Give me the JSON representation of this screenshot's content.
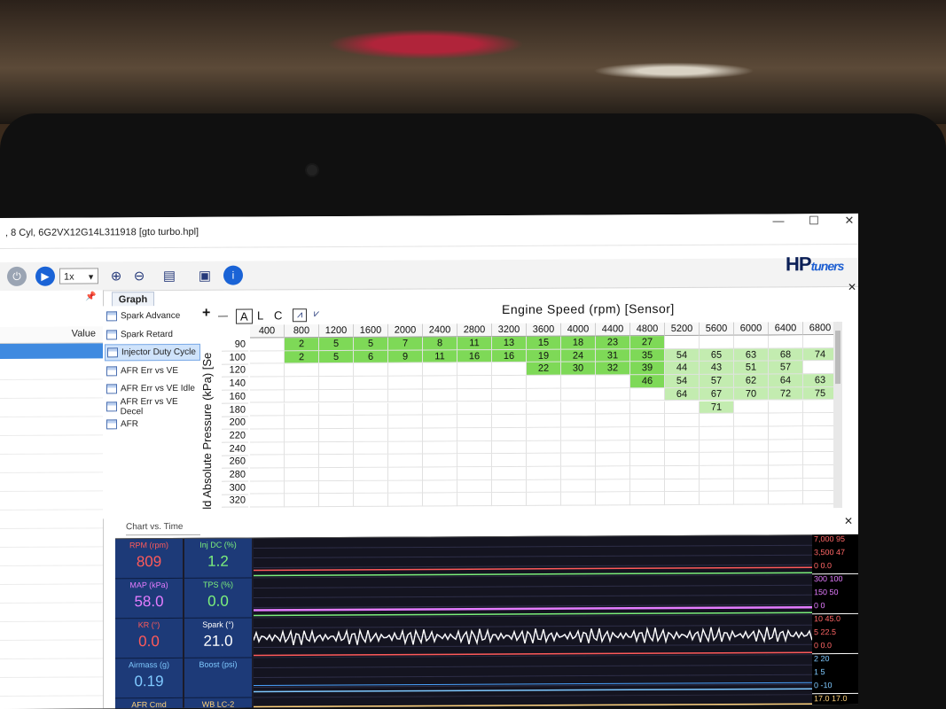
{
  "window": {
    "title": ", 8 Cyl, 6G2VX12G14L311918 [gto turbo.hpl]",
    "controls": {
      "minimize": "—",
      "maximize": "☐",
      "close": "✕"
    }
  },
  "toolbar": {
    "playback_rate": "1x",
    "logo_main": "HP",
    "logo_sub": "tuners"
  },
  "left_panel": {
    "value_header": "Value",
    "pin": "📌"
  },
  "tabs": {
    "graph_tab": "Graph",
    "items": [
      "Spark Advance",
      "Spark Retard",
      "Injector Duty Cycle",
      "AFR Err vs VE",
      "AFR Err vs VE Idle",
      "AFR Err vs VE Decel",
      "AFR"
    ],
    "selected": "Injector Duty Cycle"
  },
  "graph_toolbar": {
    "plus": "+",
    "minus": "—",
    "a": "A",
    "l": "L",
    "c": "C"
  },
  "table": {
    "x_title": "Engine Speed (rpm) [Sensor]",
    "y_title": "ld Absolute Pressure (kPa) [Se",
    "cols": [
      "400",
      "800",
      "1200",
      "1600",
      "2000",
      "2400",
      "2800",
      "3200",
      "3600",
      "4000",
      "4400",
      "4800",
      "5200",
      "5600",
      "6000",
      "6400",
      "6800"
    ],
    "rows": [
      {
        "kpa": "90",
        "cells": [
          "",
          "2",
          "5",
          "5",
          "7",
          "8",
          "11",
          "13",
          "15",
          "18",
          "23",
          "27",
          "",
          "",
          "",
          "",
          ""
        ]
      },
      {
        "kpa": "100",
        "cells": [
          "",
          "2",
          "5",
          "6",
          "9",
          "11",
          "16",
          "16",
          "19",
          "24",
          "31",
          "35",
          "54",
          "65",
          "63",
          "68",
          "74"
        ]
      },
      {
        "kpa": "120",
        "cells": [
          "",
          "",
          "",
          "",
          "",
          "",
          "",
          "",
          "22",
          "30",
          "32",
          "39",
          "44",
          "43",
          "51",
          "57",
          ""
        ]
      },
      {
        "kpa": "140",
        "cells": [
          "",
          "",
          "",
          "",
          "",
          "",
          "",
          "",
          "",
          "",
          "",
          "46",
          "54",
          "57",
          "62",
          "64",
          "63"
        ]
      },
      {
        "kpa": "160",
        "cells": [
          "",
          "",
          "",
          "",
          "",
          "",
          "",
          "",
          "",
          "",
          "",
          "",
          "64",
          "67",
          "70",
          "72",
          "75"
        ]
      },
      {
        "kpa": "180",
        "cells": [
          "",
          "",
          "",
          "",
          "",
          "",
          "",
          "",
          "",
          "",
          "",
          "",
          "",
          "71",
          "",
          "",
          ""
        ]
      },
      {
        "kpa": "200",
        "cells": [
          "",
          "",
          "",
          "",
          "",
          "",
          "",
          "",
          "",
          "",
          "",
          "",
          "",
          "",
          "",
          "",
          ""
        ]
      },
      {
        "kpa": "220",
        "cells": [
          "",
          "",
          "",
          "",
          "",
          "",
          "",
          "",
          "",
          "",
          "",
          "",
          "",
          "",
          "",
          "",
          ""
        ]
      },
      {
        "kpa": "240",
        "cells": [
          "",
          "",
          "",
          "",
          "",
          "",
          "",
          "",
          "",
          "",
          "",
          "",
          "",
          "",
          "",
          "",
          ""
        ]
      },
      {
        "kpa": "260",
        "cells": [
          "",
          "",
          "",
          "",
          "",
          "",
          "",
          "",
          "",
          "",
          "",
          "",
          "",
          "",
          "",
          "",
          ""
        ]
      },
      {
        "kpa": "280",
        "cells": [
          "",
          "",
          "",
          "",
          "",
          "",
          "",
          "",
          "",
          "",
          "",
          "",
          "",
          "",
          "",
          "",
          ""
        ]
      },
      {
        "kpa": "300",
        "cells": [
          "",
          "",
          "",
          "",
          "",
          "",
          "",
          "",
          "",
          "",
          "",
          "",
          "",
          "",
          "",
          "",
          ""
        ]
      },
      {
        "kpa": "320",
        "cells": [
          "",
          "",
          "",
          "",
          "",
          "",
          "",
          "",
          "",
          "",
          "",
          "",
          "",
          "",
          "",
          "",
          ""
        ]
      }
    ],
    "colors": {
      "bright": "#7ed957",
      "light": "#c3ecb0",
      "empty": "#ffffff"
    }
  },
  "chart": {
    "tab": "Chart vs. Time",
    "gauges": [
      {
        "label": "RPM (rpm)",
        "value": "809",
        "color": "#ff5a5a"
      },
      {
        "label": "Inj DC (%)",
        "value": "1.2",
        "color": "#7cf07c"
      },
      {
        "label": "MAP (kPa)",
        "value": "58.0",
        "color": "#e47cff"
      },
      {
        "label": "TPS (%)",
        "value": "0.0",
        "color": "#7cf07c"
      },
      {
        "label": "KR (°)",
        "value": "0.0",
        "color": "#ff5a5a"
      },
      {
        "label": "Spark (°)",
        "value": "21.0",
        "color": "#ffffff"
      },
      {
        "label": "Airmass (g)",
        "value": "0.19",
        "color": "#7fc9ff"
      },
      {
        "label": "Boost (psi)",
        "value": "",
        "color": "#7fc9ff"
      },
      {
        "label": "AFR Cmd",
        "value": "",
        "color": "#ffd27a"
      },
      {
        "label": "WB LC-2",
        "value": "",
        "color": "#ffd27a"
      }
    ],
    "scales": [
      [
        {
          "t": "7,000 95",
          "c": "#ff6666"
        },
        {
          "t": "3,500 47",
          "c": "#ff6666"
        },
        {
          "t": "0    0.0",
          "c": "#ff6666"
        }
      ],
      [
        {
          "t": "300 100",
          "c": "#e47cff"
        },
        {
          "t": "150 50",
          "c": "#e47cff"
        },
        {
          "t": "0    0",
          "c": "#e47cff"
        }
      ],
      [
        {
          "t": "10 45.0",
          "c": "#ff6666"
        },
        {
          "t": "5   22.5",
          "c": "#ff6666"
        },
        {
          "t": "0   0.0",
          "c": "#ff6666"
        }
      ],
      [
        {
          "t": "2 20",
          "c": "#7fc9ff"
        },
        {
          "t": "1 5",
          "c": "#7fc9ff"
        },
        {
          "t": "0 -10",
          "c": "#7fc9ff"
        }
      ],
      [
        {
          "t": "17.0 17.0",
          "c": "#ffd27a"
        }
      ]
    ]
  }
}
